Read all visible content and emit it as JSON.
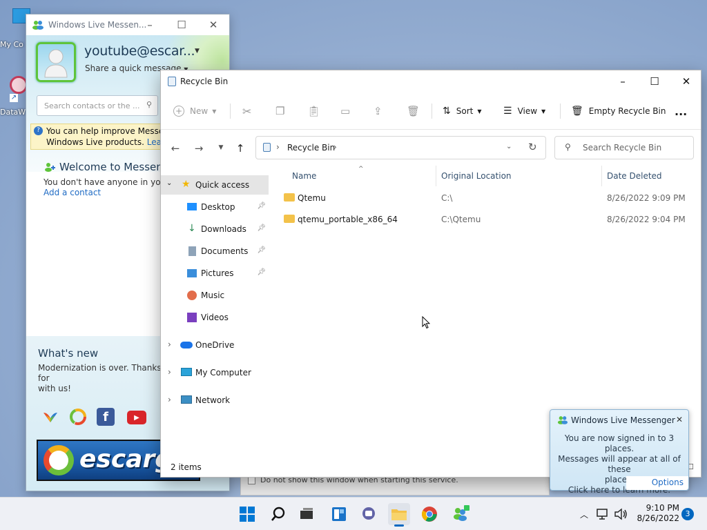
{
  "desktop": {
    "icons": [
      {
        "label": "My Co"
      },
      {
        "label": "DataW"
      }
    ]
  },
  "messenger": {
    "title": "Windows Live Messen...",
    "username": "youtube@escar...",
    "status": "Share a quick message",
    "search_placeholder": "Search contacts or the ...",
    "info_line1": "You can help improve Messeng",
    "info_line2": "Windows Live products.",
    "info_link": "Learn m",
    "welcome": "Welcome to Messeng",
    "no_contacts": "You don't have anyone in your c",
    "add_contact": "Add a contact",
    "whats_new_title": "What's new",
    "whats_new_line1": "Modernization is over. Thanks for",
    "whats_new_line2": "with us!",
    "banner_text": "escarg",
    "behind_checkbox": "Do not show this window when starting this service."
  },
  "explorer": {
    "title": "Recycle Bin",
    "toolbar": {
      "new": "New",
      "sort": "Sort",
      "view": "View",
      "empty": "Empty Recycle Bin",
      "more": "..."
    },
    "breadcrumb": "Recycle Bin",
    "search_placeholder": "Search Recycle Bin",
    "sidebar": {
      "quick_access": "Quick access",
      "items": [
        {
          "label": "Desktop",
          "pinned": true
        },
        {
          "label": "Downloads",
          "pinned": true
        },
        {
          "label": "Documents",
          "pinned": true
        },
        {
          "label": "Pictures",
          "pinned": true
        },
        {
          "label": "Music",
          "pinned": false
        },
        {
          "label": "Videos",
          "pinned": false
        }
      ],
      "onedrive": "OneDrive",
      "my_computer": "My Computer",
      "network": "Network"
    },
    "columns": {
      "name": "Name",
      "location": "Original Location",
      "deleted": "Date Deleted"
    },
    "rows": [
      {
        "name": "Qtemu",
        "location": "C:\\",
        "deleted": "8/26/2022 9:09 PM"
      },
      {
        "name": "qtemu_portable_x86_64",
        "location": "C:\\Qtemu",
        "deleted": "8/26/2022 9:04 PM"
      }
    ],
    "status": "2 items"
  },
  "notification": {
    "title": "Windows Live Messenger",
    "line1": "You are now signed in to 3 places.",
    "line2": "Messages will appear at all of these",
    "line3": "places.",
    "line4": "Click here to learn more.",
    "options": "Options"
  },
  "taskbar": {
    "time": "9:10 PM",
    "date": "8/26/2022",
    "notification_count": "3"
  },
  "colors": {
    "accent": "#0067c0",
    "folder": "#f3c24a",
    "wlm_green": "#5ec43a"
  }
}
